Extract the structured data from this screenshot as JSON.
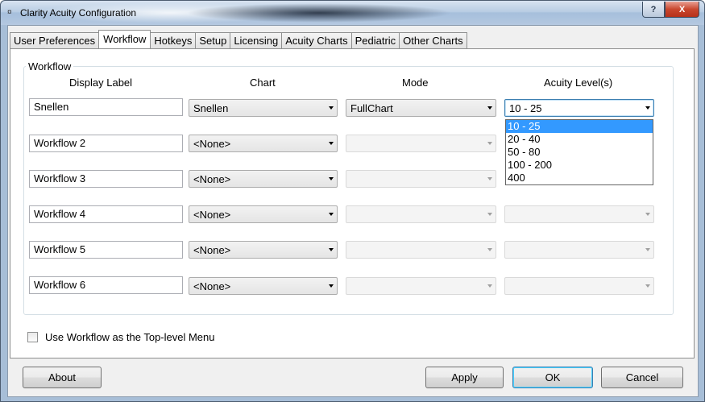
{
  "window": {
    "title": "Clarity Acuity Configuration",
    "app_icon": "app-icon",
    "help_label": "?",
    "close_label": "X"
  },
  "tabs": [
    {
      "label": "User Preferences",
      "active": false
    },
    {
      "label": "Workflow",
      "active": true
    },
    {
      "label": "Hotkeys",
      "active": false
    },
    {
      "label": "Setup",
      "active": false
    },
    {
      "label": "Licensing",
      "active": false
    },
    {
      "label": "Acuity Charts",
      "active": false
    },
    {
      "label": "Pediatric",
      "active": false
    },
    {
      "label": "Other Charts",
      "active": false
    }
  ],
  "workflow": {
    "group_label": "Workflow",
    "headers": {
      "display_label": "Display Label",
      "chart": "Chart",
      "mode": "Mode",
      "acuity_levels": "Acuity Level(s)"
    },
    "rows": [
      {
        "label": "Snellen",
        "chart": "Snellen",
        "mode": "FullChart",
        "acuity": "10 - 25"
      },
      {
        "label": "Workflow 2",
        "chart": "<None>",
        "mode": "",
        "acuity": ""
      },
      {
        "label": "Workflow 3",
        "chart": "<None>",
        "mode": "",
        "acuity": ""
      },
      {
        "label": "Workflow 4",
        "chart": "<None>",
        "mode": "",
        "acuity": ""
      },
      {
        "label": "Workflow 5",
        "chart": "<None>",
        "mode": "",
        "acuity": ""
      },
      {
        "label": "Workflow 6",
        "chart": "<None>",
        "mode": "",
        "acuity": ""
      }
    ],
    "acuity_dropdown_options": [
      "10 - 25",
      "20 - 40",
      "50 - 80",
      "100 - 200",
      "400"
    ],
    "acuity_dropdown_selected": "10 - 25"
  },
  "options": {
    "top_level_menu_label": "Use Workflow as the Top-level Menu",
    "top_level_menu_checked": false
  },
  "buttons": {
    "about": "About",
    "apply": "Apply",
    "ok": "OK",
    "cancel": "Cancel"
  },
  "colors": {
    "selection": "#3399ff",
    "focus_border": "#3c7fb1"
  }
}
